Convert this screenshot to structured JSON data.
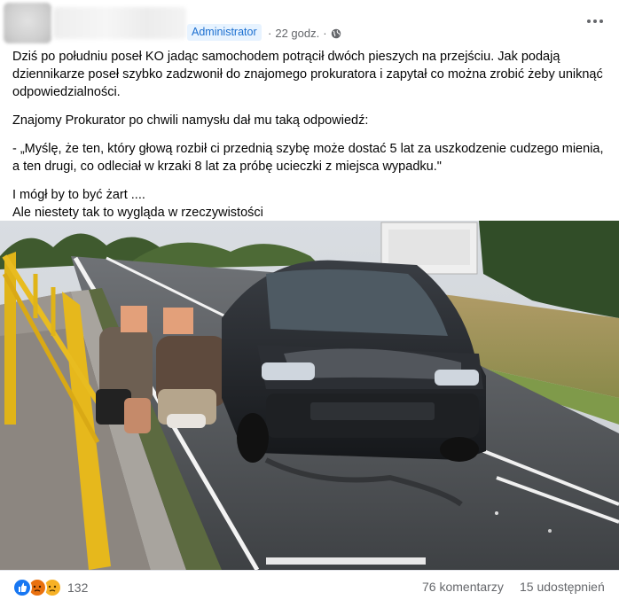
{
  "post": {
    "badge": "Administrator",
    "time": "22 godz.",
    "meta_separator": "·",
    "privacy_icon": "globe-icon",
    "more_icon": "more-options-icon",
    "paragraphs": [
      "Dziś po południu poseł KO jadąc samochodem potrącił dwóch pieszych na przejściu. Jak podają dziennikarze poseł szybko zadzwonił do znajomego prokuratora i zapytał co można zrobić żeby uniknąć odpowiedzialności.",
      "Znajomy Prokurator po chwili namysłu dał mu taką odpowiedź:",
      "- „Myślę, że ten, który głową rozbił ci przednią szybę może dostać 5 lat za uszkodzenie cudzego mienia, a ten drugi, co odleciał w krzaki 8 lat za próbę ucieczki z miejsca wypadku.\"",
      "I mógł by to być żart ....",
      "Ale niestety tak to wygląda w rzeczywistości"
    ]
  },
  "footer": {
    "reaction_icons": [
      "like-icon",
      "angry-icon",
      "sad-icon"
    ],
    "reaction_count": "132",
    "comments": "76 komentarzy",
    "shares": "15 udostępnień"
  },
  "colors": {
    "badge_bg": "#e7f3ff",
    "badge_text": "#1b6fd0",
    "secondary_text": "#65676b",
    "like": "#1877f2",
    "angry": "#e9710f",
    "sad": "#f7b125"
  }
}
